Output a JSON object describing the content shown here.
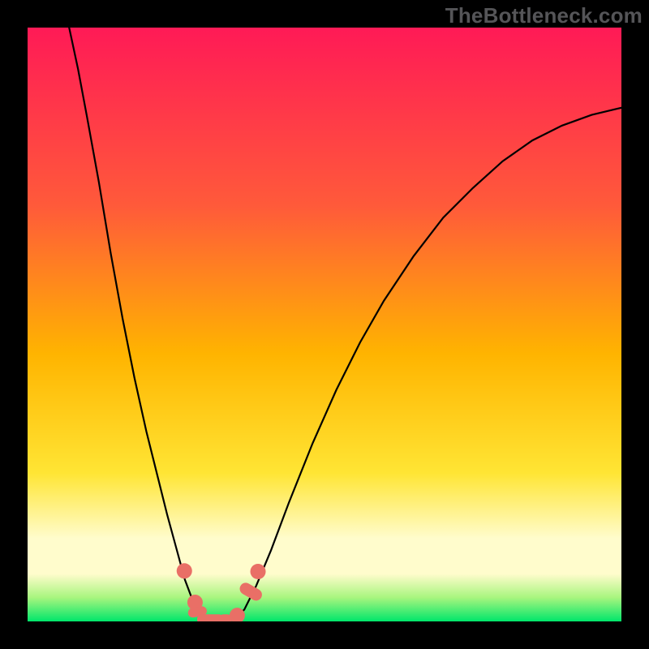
{
  "watermark": "TheBottleneck.com",
  "colors": {
    "bg_black": "#000000",
    "grad_top": "#ff1a56",
    "grad_mid1": "#ff5a3a",
    "grad_mid2": "#ffb400",
    "grad_mid3": "#ffe534",
    "grad_pale": "#fffccc",
    "grad_green1": "#a7f57e",
    "grad_green2": "#00e66b",
    "curve": "#000000",
    "marker": "#e96f66"
  },
  "chart_data": {
    "type": "line",
    "title": "",
    "xlabel": "",
    "ylabel": "",
    "xlim": [
      0,
      100
    ],
    "ylim": [
      0,
      100
    ],
    "grid": false,
    "curve_points": [
      {
        "x": 7.0,
        "y": 100.0
      },
      {
        "x": 8.5,
        "y": 93.0
      },
      {
        "x": 10.0,
        "y": 85.0
      },
      {
        "x": 12.0,
        "y": 74.0
      },
      {
        "x": 14.0,
        "y": 62.0
      },
      {
        "x": 16.0,
        "y": 51.0
      },
      {
        "x": 18.0,
        "y": 41.0
      },
      {
        "x": 20.0,
        "y": 32.0
      },
      {
        "x": 22.0,
        "y": 24.0
      },
      {
        "x": 23.5,
        "y": 18.0
      },
      {
        "x": 25.0,
        "y": 12.5
      },
      {
        "x": 26.5,
        "y": 7.0
      },
      {
        "x": 28.0,
        "y": 3.0
      },
      {
        "x": 29.5,
        "y": 0.8
      },
      {
        "x": 31.0,
        "y": 0.0
      },
      {
        "x": 33.0,
        "y": 0.0
      },
      {
        "x": 35.0,
        "y": 0.5
      },
      {
        "x": 36.5,
        "y": 2.0
      },
      {
        "x": 38.5,
        "y": 6.0
      },
      {
        "x": 41.0,
        "y": 12.0
      },
      {
        "x": 44.0,
        "y": 20.0
      },
      {
        "x": 48.0,
        "y": 30.0
      },
      {
        "x": 52.0,
        "y": 39.0
      },
      {
        "x": 56.0,
        "y": 47.0
      },
      {
        "x": 60.0,
        "y": 54.0
      },
      {
        "x": 65.0,
        "y": 61.5
      },
      {
        "x": 70.0,
        "y": 68.0
      },
      {
        "x": 75.0,
        "y": 73.0
      },
      {
        "x": 80.0,
        "y": 77.5
      },
      {
        "x": 85.0,
        "y": 81.0
      },
      {
        "x": 90.0,
        "y": 83.5
      },
      {
        "x": 95.0,
        "y": 85.3
      },
      {
        "x": 100.0,
        "y": 86.5
      }
    ],
    "markers": [
      {
        "x": 26.4,
        "y": 8.5,
        "shape": "circle",
        "size": 1.3
      },
      {
        "x": 28.2,
        "y": 3.2,
        "shape": "circle",
        "size": 1.3
      },
      {
        "x": 28.6,
        "y": 1.6,
        "shape": "pill",
        "w": 1.6,
        "h": 3.2,
        "angle": 80
      },
      {
        "x": 30.8,
        "y": 0.35,
        "shape": "pill",
        "w": 4.5,
        "h": 1.7,
        "angle": 0
      },
      {
        "x": 33.3,
        "y": 0.35,
        "shape": "pill",
        "w": 2.3,
        "h": 1.7,
        "angle": 0
      },
      {
        "x": 35.3,
        "y": 1.0,
        "shape": "circle",
        "size": 1.3
      },
      {
        "x": 37.6,
        "y": 5.0,
        "shape": "pill",
        "w": 2.0,
        "h": 4.0,
        "angle": -60
      },
      {
        "x": 38.8,
        "y": 8.4,
        "shape": "circle",
        "size": 1.3
      }
    ],
    "gradient_stops": [
      {
        "offset": 0.0,
        "color_key": "grad_top"
      },
      {
        "offset": 0.3,
        "color_key": "grad_mid1"
      },
      {
        "offset": 0.55,
        "color_key": "grad_mid2"
      },
      {
        "offset": 0.75,
        "color_key": "grad_mid3"
      },
      {
        "offset": 0.86,
        "color_key": "grad_pale"
      },
      {
        "offset": 0.92,
        "color_key": "grad_pale"
      },
      {
        "offset": 0.96,
        "color_key": "grad_green1"
      },
      {
        "offset": 1.0,
        "color_key": "grad_green2"
      }
    ]
  }
}
